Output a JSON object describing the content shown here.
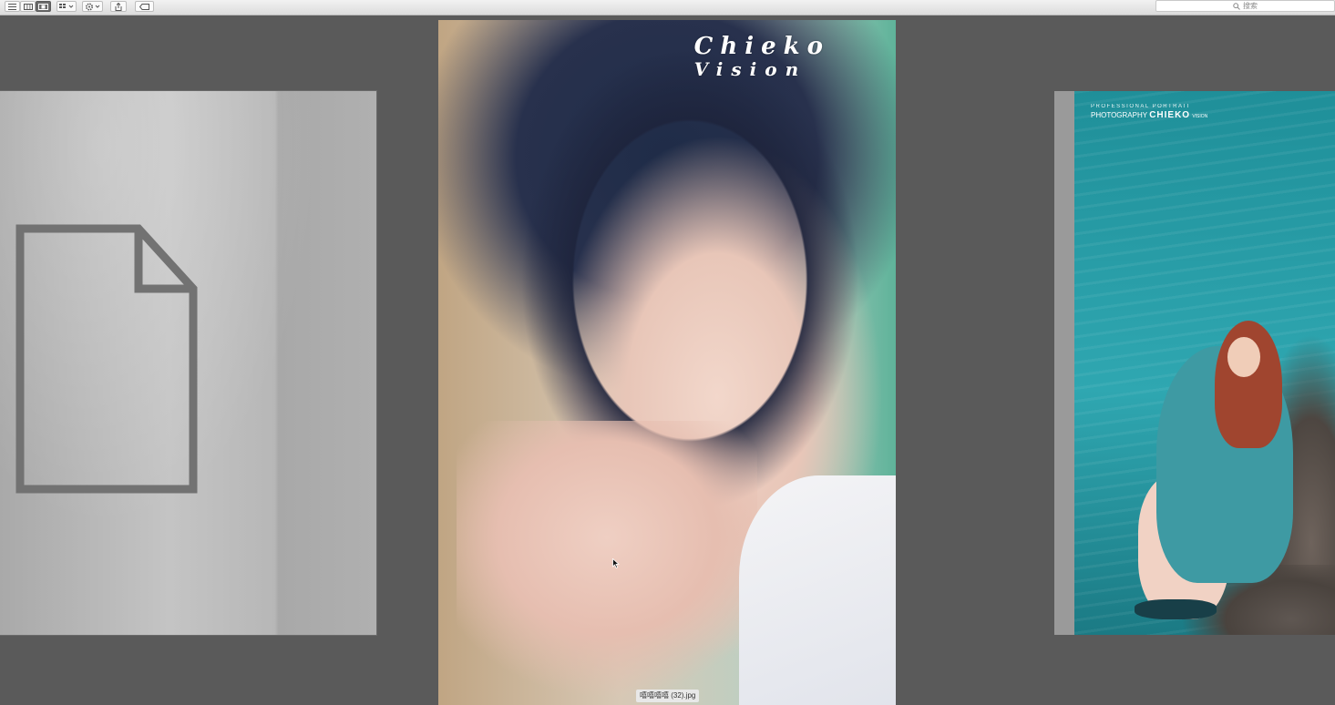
{
  "toolbar": {
    "view_buttons": [
      {
        "name": "list-view",
        "active": false
      },
      {
        "name": "column-view",
        "active": false
      },
      {
        "name": "cover-flow-view",
        "active": true
      }
    ],
    "search": {
      "placeholder": "搜索"
    }
  },
  "coverflow": {
    "center": {
      "watermark_line1": "Chieko",
      "watermark_line2": "Vision",
      "filename": "嘻嘻嘻嘻 (32).jpg"
    },
    "right": {
      "watermark_line1": "PROFESSIONAL PORTRAIT",
      "watermark_line2": "PHOTOGRAPHY",
      "watermark_brand": "CHIEKO",
      "watermark_suffix": "VISION"
    }
  },
  "colors": {
    "stage_bg": "#5a5a5a",
    "toolbar_bg": "#e6e6e6",
    "water": "#2aa2ad"
  }
}
